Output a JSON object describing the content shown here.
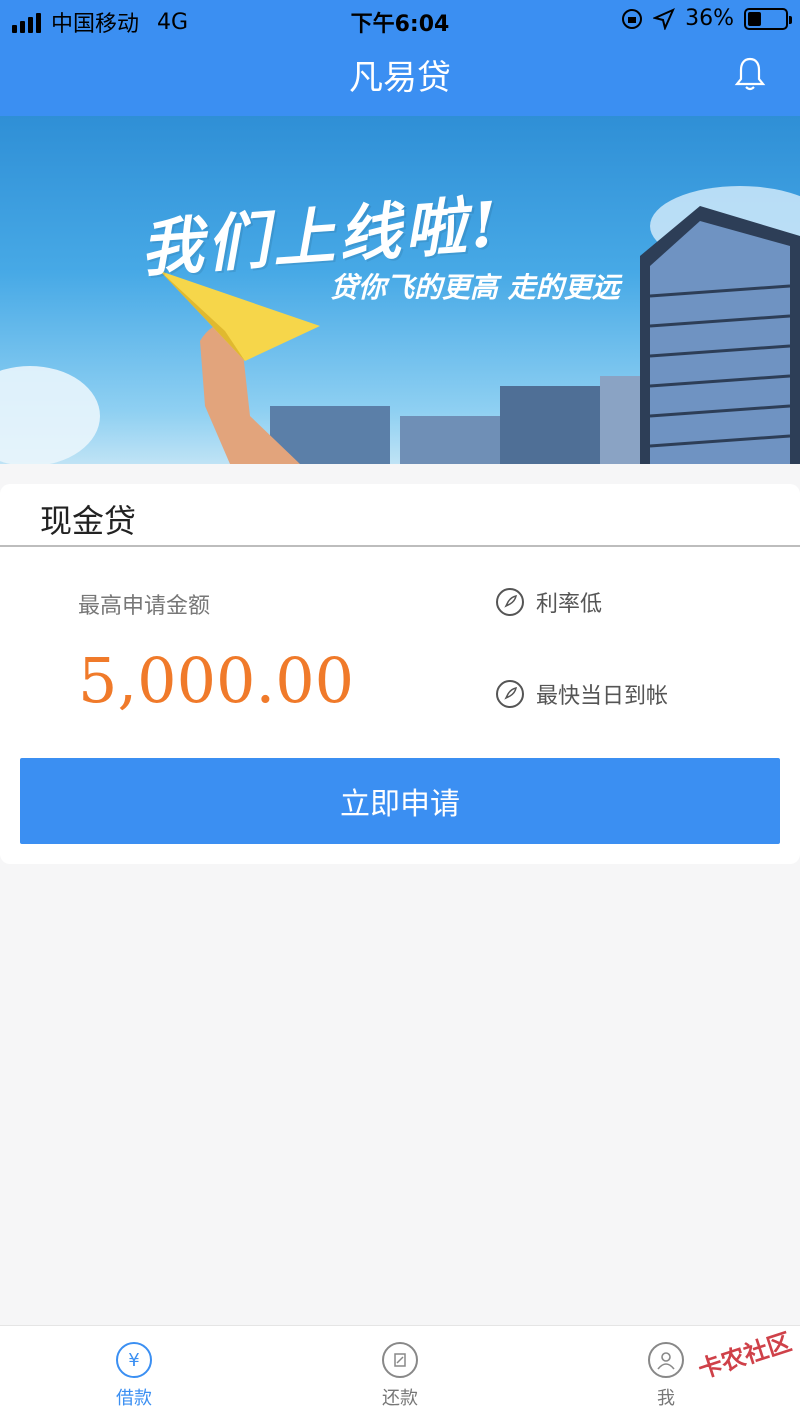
{
  "status_bar": {
    "carrier": "中国移动",
    "network": "4G",
    "time": "下午6:04",
    "battery_text": "36%",
    "battery_level": 0.36
  },
  "header": {
    "title": "凡易贷",
    "bell_icon": "bell-icon"
  },
  "banner": {
    "headline": "我们上线啦!",
    "slogan": "贷你飞的更高 走的更远"
  },
  "card": {
    "title": "现金贷",
    "amount_label": "最高申请金额",
    "amount_value": "5,000.00",
    "features": [
      {
        "label": "利率低",
        "icon": "rocket-icon"
      },
      {
        "label": "最快当日到帐",
        "icon": "rocket-icon"
      }
    ],
    "apply_button": "立即申请"
  },
  "tabbar": {
    "tabs": [
      {
        "label": "借款",
        "icon": "money-bag-icon",
        "active": true
      },
      {
        "label": "还款",
        "icon": "repay-icon",
        "active": false
      },
      {
        "label": "我",
        "icon": "user-icon",
        "active": false
      }
    ]
  },
  "watermark": "卡农社区",
  "colors": {
    "primary": "#3b8ff2",
    "amount": "#f07a2a",
    "background": "#f6f6f7"
  }
}
